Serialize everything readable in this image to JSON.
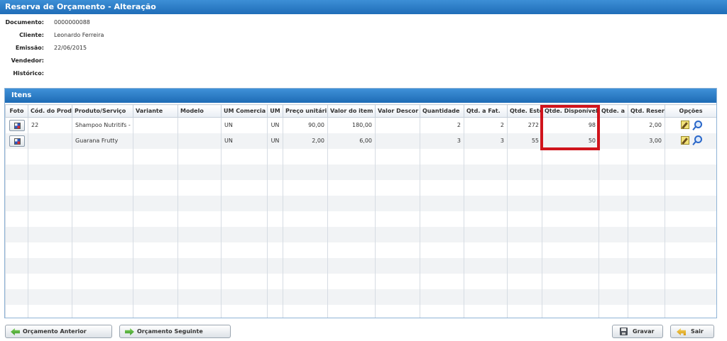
{
  "window": {
    "title": "Reserva de Orçamento - Alteração"
  },
  "header": {
    "fields": [
      {
        "label": "Documento:",
        "value": "0000000088"
      },
      {
        "label": "Cliente:",
        "value": "Leonardo Ferreira"
      },
      {
        "label": "Emissão:",
        "value": "22/06/2015"
      },
      {
        "label": "Vendedor:",
        "value": ""
      },
      {
        "label": "Histórico:",
        "value": ""
      }
    ]
  },
  "items_panel": {
    "title": "Itens",
    "columns": [
      "Foto",
      "Cód. do Prod",
      "Produto/Serviço",
      "Variante",
      "Modelo",
      "UM Comercia",
      "UM",
      "Preço unitári",
      "Valor do item",
      "Valor Descor",
      "Quantidade",
      "Qtd. a Fat.",
      "Qtde. Este",
      "Qtde. Disponível",
      "Qtde. a",
      "Qtd. Reser",
      "Opções"
    ],
    "rows": [
      {
        "codigo": "22",
        "produto": "Shampoo Nutritifs -",
        "variante": "",
        "modelo": "",
        "um_comercial": "UN",
        "um": "UN",
        "preco_unitario": "90,00",
        "valor_item": "180,00",
        "valor_desconto": "",
        "quantidade": "2",
        "qtd_faturar": "2",
        "qtde_estoque": "272",
        "qtde_disponivel": "98",
        "qtde_a": "",
        "qtd_reservada": "2,00"
      },
      {
        "codigo": "",
        "produto": "Guarana Frutty",
        "variante": "",
        "modelo": "",
        "um_comercial": "UN",
        "um": "UN",
        "preco_unitario": "2,00",
        "valor_item": "6,00",
        "valor_desconto": "",
        "quantidade": "3",
        "qtd_faturar": "3",
        "qtde_estoque": "55",
        "qtde_disponivel": "50",
        "qtde_a": "",
        "qtd_reservada": "3,00"
      }
    ]
  },
  "footer": {
    "prev_label": "Orçamento Anterior",
    "next_label": "Orçamento Seguinte",
    "save_label": "Gravar",
    "exit_label": "Sair"
  },
  "colors": {
    "title_bar": "#1f6db8",
    "highlight": "#d0141c"
  }
}
